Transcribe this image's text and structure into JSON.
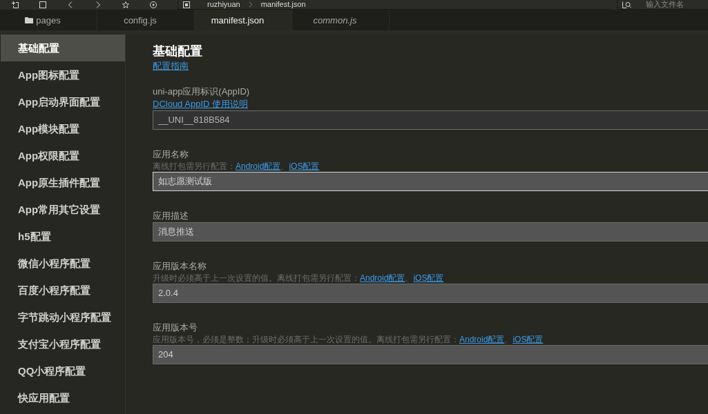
{
  "toolbar": {
    "breadcrumb": [
      "ruzhiyuan",
      "manifest.json"
    ],
    "search": {
      "placeholder": "输入文件名"
    }
  },
  "tabs": [
    {
      "label": "pages",
      "kind": "folder",
      "selected": false,
      "preview": false
    },
    {
      "label": "config.js",
      "kind": "file",
      "selected": false,
      "preview": false
    },
    {
      "label": "manifest.json",
      "kind": "file",
      "selected": true,
      "preview": false
    },
    {
      "label": "common.js",
      "kind": "file",
      "selected": false,
      "preview": true
    }
  ],
  "sidebar": {
    "items": [
      {
        "label": "基础配置",
        "selected": true
      },
      {
        "label": "App图标配置",
        "selected": false
      },
      {
        "label": "App启动界面配置",
        "selected": false
      },
      {
        "label": "App模块配置",
        "selected": false
      },
      {
        "label": "App权限配置",
        "selected": false
      },
      {
        "label": "App原生插件配置",
        "selected": false
      },
      {
        "label": "App常用其它设置",
        "selected": false
      },
      {
        "label": "h5配置",
        "selected": false
      },
      {
        "label": "微信小程序配置",
        "selected": false
      },
      {
        "label": "百度小程序配置",
        "selected": false
      },
      {
        "label": "字节跳动小程序配置",
        "selected": false
      },
      {
        "label": "支付宝小程序配置",
        "selected": false
      },
      {
        "label": "QQ小程序配置",
        "selected": false
      },
      {
        "label": "快应用配置",
        "selected": false
      }
    ]
  },
  "content": {
    "title": "基础配置",
    "guide_link": "配置指南",
    "fields": [
      {
        "label": "uni-app应用标识(AppID)",
        "link": "DCloud AppID 使用说明",
        "value": "__UNI__818B584",
        "disabled": true,
        "focused": false
      },
      {
        "label": "应用名称",
        "hint": [
          {
            "kind": "text",
            "text": "离线打包需另行配置："
          },
          {
            "kind": "link",
            "text": "Android配置"
          },
          {
            "kind": "text",
            "text": "、"
          },
          {
            "kind": "link",
            "text": "iOS配置"
          }
        ],
        "value": "如志愿测试版",
        "disabled": false,
        "focused": true
      },
      {
        "label": "应用描述",
        "value": "消息推送",
        "disabled": false,
        "focused": false
      },
      {
        "label": "应用版本名称",
        "hint": [
          {
            "kind": "text",
            "text": "升级时必须高于上一次设置的值。离线打包需另行配置："
          },
          {
            "kind": "link",
            "text": "Android配置"
          },
          {
            "kind": "text",
            "text": "、"
          },
          {
            "kind": "link",
            "text": "iOS配置"
          }
        ],
        "value": "2.0.4",
        "disabled": false,
        "focused": false
      },
      {
        "label": "应用版本号",
        "hint": [
          {
            "kind": "text",
            "text": "应用版本号，必须是整数；升级时必须高于上一次设置的值。离线打包需另行配置："
          },
          {
            "kind": "link",
            "text": "Android配置"
          },
          {
            "kind": "text",
            "text": "、"
          },
          {
            "kind": "link",
            "text": "iOS配置"
          }
        ],
        "value": "204",
        "disabled": false,
        "focused": false
      }
    ]
  }
}
